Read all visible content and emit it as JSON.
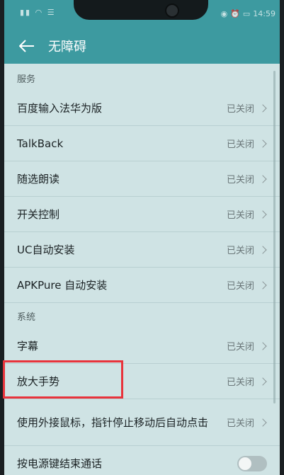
{
  "status_bar": {
    "left_glyphs": "▮▮ ◠ ☰",
    "time": "14:59",
    "icons": [
      "eye-icon",
      "alarm-icon",
      "battery-icon"
    ]
  },
  "header": {
    "title": "无障碍",
    "back_icon": "arrow-left-icon"
  },
  "sections": [
    {
      "title": "服务",
      "items": [
        {
          "label": "百度输入法华为版",
          "status": "已关闭"
        },
        {
          "label": "TalkBack",
          "status": "已关闭"
        },
        {
          "label": "随选朗读",
          "status": "已关闭"
        },
        {
          "label": "开关控制",
          "status": "已关闭"
        },
        {
          "label": "UC自动安装",
          "status": "已关闭"
        },
        {
          "label": "APKPure 自动安装",
          "status": "已关闭"
        }
      ]
    },
    {
      "title": "系统",
      "items": [
        {
          "label": "字幕",
          "status": "已关闭"
        },
        {
          "label": "放大手势",
          "status": "已关闭"
        },
        {
          "label": "使用外接鼠标，指针停止移动后自动点击",
          "status": "已关闭"
        },
        {
          "label": "按电源键结束通话",
          "toggle": false
        }
      ]
    }
  ],
  "colors": {
    "accent": "#3d9aa0",
    "background": "#cfe3e4",
    "highlight": "#e8333b"
  }
}
